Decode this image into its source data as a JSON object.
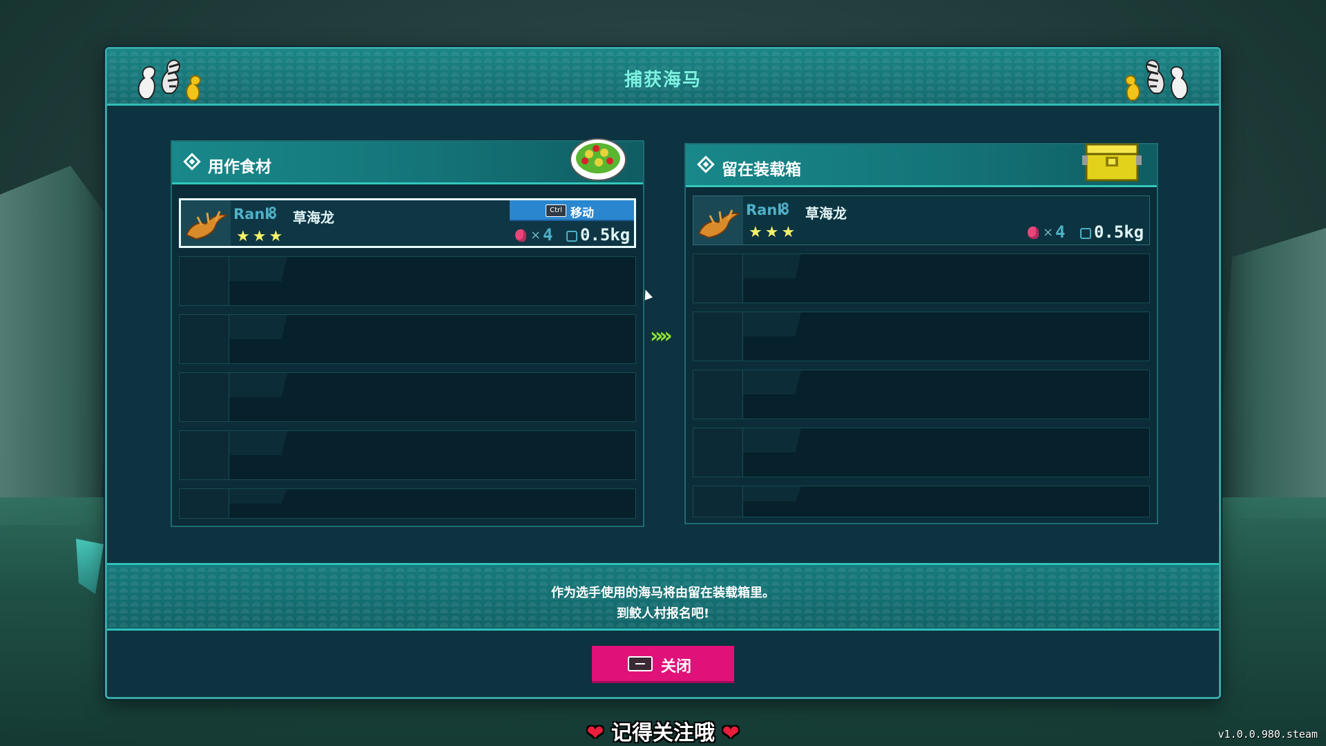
{
  "window": {
    "title": "捕获海马"
  },
  "left_panel": {
    "title": "用作食材",
    "icon": "salad-bowl-icon",
    "slots": [
      {
        "filled": true,
        "selected": true,
        "rank_label": "Rank",
        "rank_value": "8",
        "name": "草海龙",
        "stars": "★★★",
        "meat_x": "×",
        "meat_count": "4",
        "weight": "0.5kg",
        "action_key": "Ctrl",
        "action_label": "移动"
      },
      {
        "filled": false
      },
      {
        "filled": false
      },
      {
        "filled": false
      },
      {
        "filled": false
      },
      {
        "filled": false
      }
    ]
  },
  "right_panel": {
    "title": "留在装载箱",
    "icon": "storage-chest-icon",
    "slots": [
      {
        "filled": true,
        "rank_label": "Rank",
        "rank_value": "8",
        "name": "草海龙",
        "stars": "★★★",
        "meat_x": "×",
        "meat_count": "4",
        "weight": "0.5kg"
      },
      {
        "filled": false
      },
      {
        "filled": false
      },
      {
        "filled": false
      },
      {
        "filled": false
      },
      {
        "filled": false
      }
    ]
  },
  "transfer_arrows": "»»",
  "info": {
    "line1": "作为选手使用的海马将由留在装载箱里。",
    "line2": "到鲛人村报名吧!"
  },
  "close_button": {
    "label": "关闭"
  },
  "overlay": {
    "follow_text": "记得关注哦",
    "heart": "❤",
    "version": "v1.0.0.980.steam"
  },
  "colors": {
    "accent_teal": "#2fc0b8",
    "close_button": "#e0127a",
    "move_button": "#2a86cf",
    "star": "#f4f26a"
  }
}
